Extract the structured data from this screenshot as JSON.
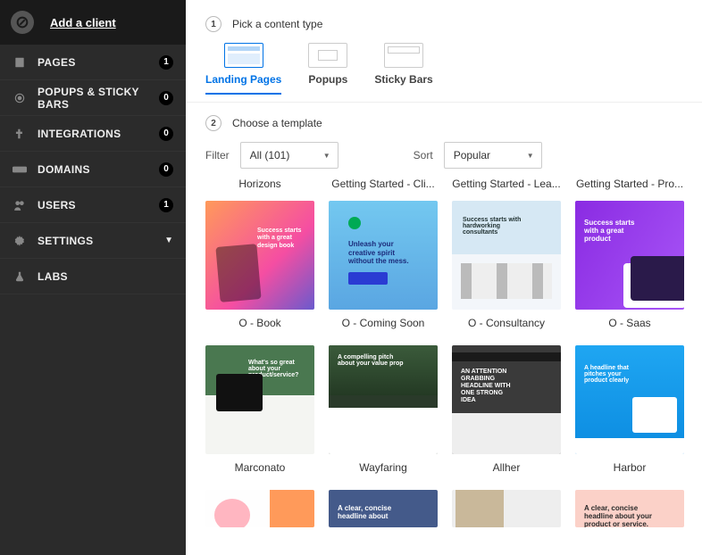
{
  "header": {
    "add_client": "Add a client"
  },
  "sidebar": {
    "items": [
      {
        "icon": "pages-icon",
        "label": "PAGES",
        "badge": "1"
      },
      {
        "icon": "popups-icon",
        "label": "POPUPS & STICKY BARS",
        "badge": "0"
      },
      {
        "icon": "integrations-icon",
        "label": "INTEGRATIONS",
        "badge": "0"
      },
      {
        "icon": "domains-icon",
        "label": "DOMAINS",
        "badge": "0"
      },
      {
        "icon": "users-icon",
        "label": "USERS",
        "badge": "1"
      },
      {
        "icon": "settings-icon",
        "label": "SETTINGS",
        "chevron": "▼"
      },
      {
        "icon": "labs-icon",
        "label": "LABS"
      }
    ]
  },
  "steps": {
    "one_num": "1",
    "one_label": "Pick a content type",
    "two_num": "2",
    "two_label": "Choose a template"
  },
  "tabs": {
    "landing": "Landing Pages",
    "popups": "Popups",
    "sticky": "Sticky Bars"
  },
  "filters": {
    "filter_label": "Filter",
    "filter_value": "All (101)",
    "sort_label": "Sort",
    "sort_value": "Popular"
  },
  "partial_row": [
    "Horizons",
    "Getting Started - Cli...",
    "Getting Started - Lea...",
    "Getting Started - Pro..."
  ],
  "templates_row1": [
    {
      "name": "O - Book",
      "thumb_class": "t-book",
      "thumb_text": "Success starts with a great design book"
    },
    {
      "name": "O - Coming Soon",
      "thumb_class": "t-coming",
      "thumb_text": "Unleash your creative spirit without the mess."
    },
    {
      "name": "O - Consultancy",
      "thumb_class": "t-consult",
      "thumb_text": "Success starts with hardworking consultants"
    },
    {
      "name": "O - Saas",
      "thumb_class": "t-saas",
      "thumb_text": "Success starts with a great product"
    }
  ],
  "templates_row2": [
    {
      "name": "Marconato",
      "thumb_class": "t-marconato",
      "thumb_text": "What's so great about your product/service?"
    },
    {
      "name": "Wayfaring",
      "thumb_class": "t-wayfaring",
      "thumb_text": "A compelling pitch about your value prop"
    },
    {
      "name": "Allher",
      "thumb_class": "t-allher",
      "thumb_text": "AN ATTENTION GRABBING HEADLINE WITH ONE STRONG IDEA"
    },
    {
      "name": "Harbor",
      "thumb_class": "t-harbor",
      "thumb_text": "A headline that pitches your product clearly"
    }
  ],
  "templates_row3": [
    {
      "name": "",
      "thumb_class": "t-pig",
      "thumb_text": ""
    },
    {
      "name": "",
      "thumb_class": "t-clear1",
      "thumb_text": "A clear, concise headline about"
    },
    {
      "name": "",
      "thumb_class": "t-face",
      "thumb_text": ""
    },
    {
      "name": "",
      "thumb_class": "t-clear2",
      "thumb_text": "A clear, concise headline about your product or service."
    }
  ]
}
